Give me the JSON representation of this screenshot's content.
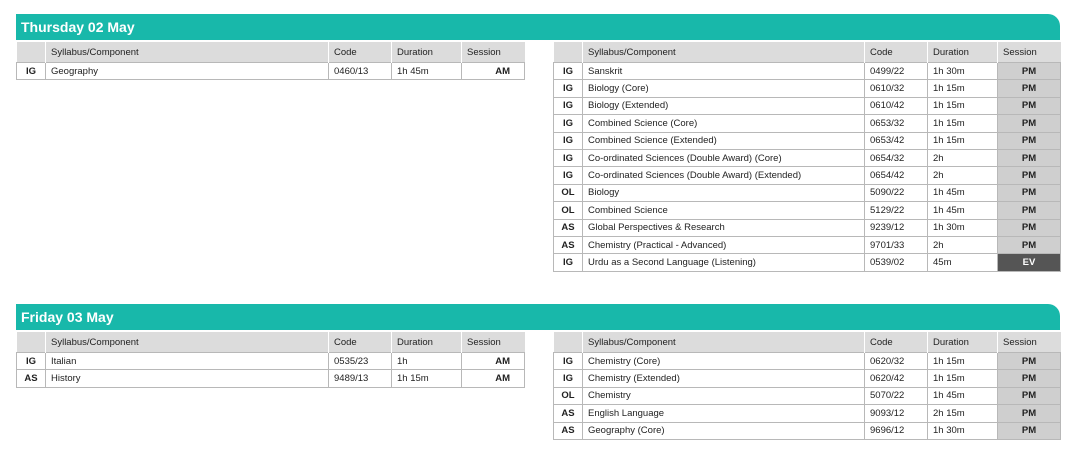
{
  "headers": {
    "syllabus": "Syllabus/Component",
    "code": "Code",
    "duration": "Duration",
    "session": "Session"
  },
  "days": [
    {
      "title": "Thursday 02 May",
      "left": [
        {
          "level": "IG",
          "syllabus": "Geography",
          "code": "0460/13",
          "duration": "1h 45m",
          "session": "AM"
        }
      ],
      "right": [
        {
          "level": "IG",
          "syllabus": "Sanskrit",
          "code": "0499/22",
          "duration": "1h 30m",
          "session": "PM"
        },
        {
          "level": "IG",
          "syllabus": "Biology (Core)",
          "code": "0610/32",
          "duration": "1h 15m",
          "session": "PM"
        },
        {
          "level": "IG",
          "syllabus": "Biology (Extended)",
          "code": "0610/42",
          "duration": "1h 15m",
          "session": "PM"
        },
        {
          "level": "IG",
          "syllabus": "Combined Science (Core)",
          "code": "0653/32",
          "duration": "1h 15m",
          "session": "PM"
        },
        {
          "level": "IG",
          "syllabus": "Combined Science (Extended)",
          "code": "0653/42",
          "duration": "1h 15m",
          "session": "PM"
        },
        {
          "level": "IG",
          "syllabus": "Co-ordinated Sciences (Double Award) (Core)",
          "code": "0654/32",
          "duration": "2h",
          "session": "PM"
        },
        {
          "level": "IG",
          "syllabus": "Co-ordinated Sciences (Double Award) (Extended)",
          "code": "0654/42",
          "duration": "2h",
          "session": "PM"
        },
        {
          "level": "OL",
          "syllabus": "Biology",
          "code": "5090/22",
          "duration": "1h 45m",
          "session": "PM"
        },
        {
          "level": "OL",
          "syllabus": "Combined Science",
          "code": "5129/22",
          "duration": "1h 45m",
          "session": "PM"
        },
        {
          "level": "AS",
          "syllabus": "Global Perspectives & Research",
          "code": "9239/12",
          "duration": "1h 30m",
          "session": "PM"
        },
        {
          "level": "AS",
          "syllabus": "Chemistry (Practical - Advanced)",
          "code": "9701/33",
          "duration": "2h",
          "session": "PM"
        },
        {
          "level": "IG",
          "syllabus": "Urdu as a Second Language (Listening)",
          "code": "0539/02",
          "duration": "45m",
          "session": "EV"
        }
      ]
    },
    {
      "title": "Friday 03 May",
      "left": [
        {
          "level": "IG",
          "syllabus": "Italian",
          "code": "0535/23",
          "duration": "1h",
          "session": "AM"
        },
        {
          "level": "AS",
          "syllabus": "History",
          "code": "9489/13",
          "duration": "1h 15m",
          "session": "AM"
        }
      ],
      "right": [
        {
          "level": "IG",
          "syllabus": "Chemistry (Core)",
          "code": "0620/32",
          "duration": "1h 15m",
          "session": "PM"
        },
        {
          "level": "IG",
          "syllabus": "Chemistry (Extended)",
          "code": "0620/42",
          "duration": "1h 15m",
          "session": "PM"
        },
        {
          "level": "OL",
          "syllabus": "Chemistry",
          "code": "5070/22",
          "duration": "1h 45m",
          "session": "PM"
        },
        {
          "level": "AS",
          "syllabus": "English Language",
          "code": "9093/12",
          "duration": "2h 15m",
          "session": "PM"
        },
        {
          "level": "AS",
          "syllabus": "Geography (Core)",
          "code": "9696/12",
          "duration": "1h 30m",
          "session": "PM"
        }
      ]
    }
  ]
}
